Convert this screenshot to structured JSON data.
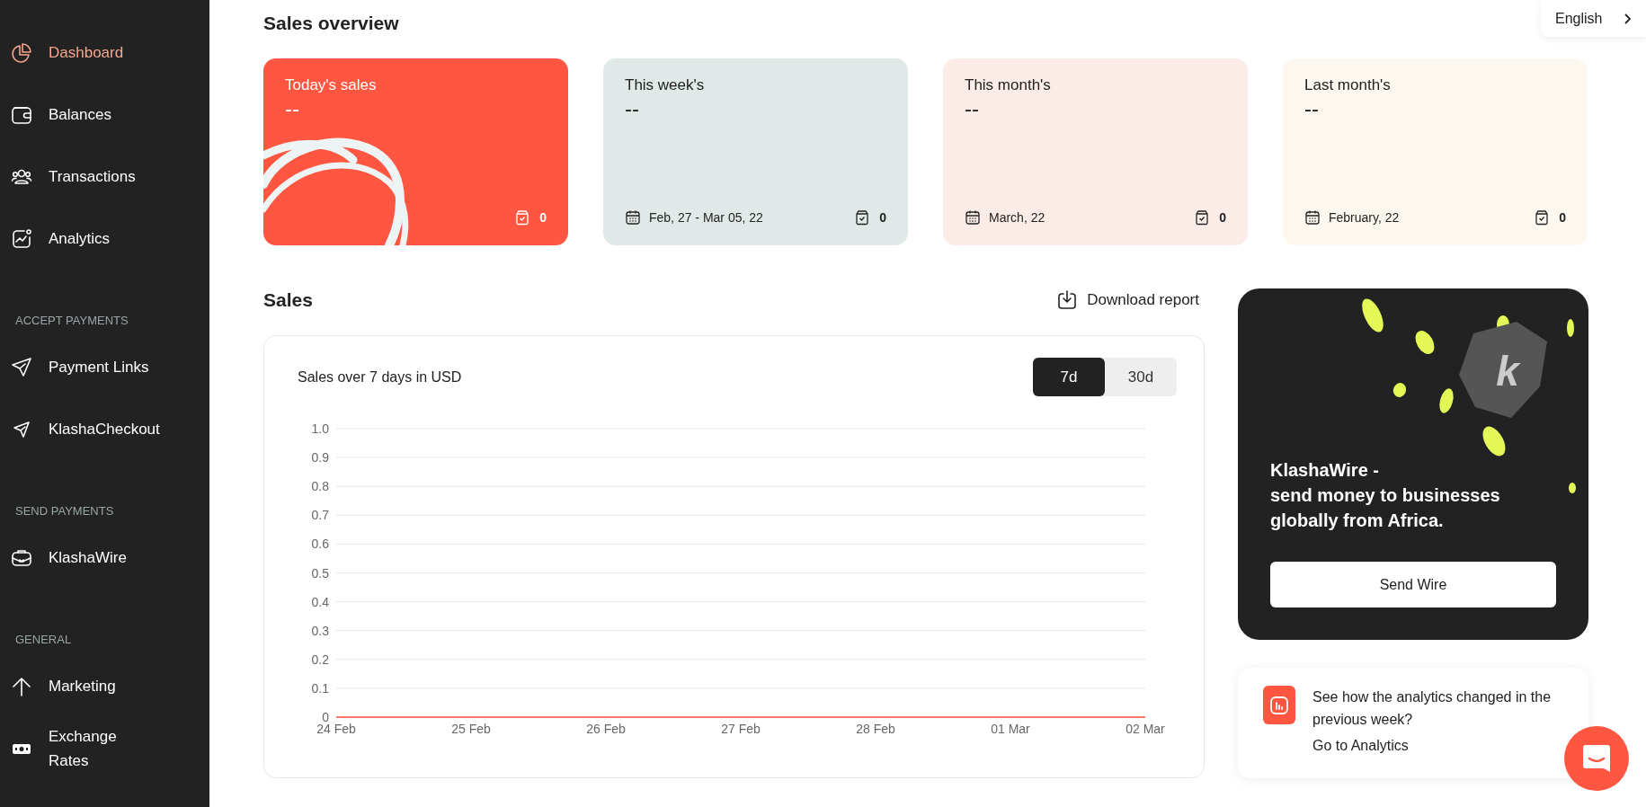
{
  "sidebar": {
    "sections": [
      {
        "items": [
          {
            "label": "Dashboard",
            "selected": true
          },
          {
            "label": "Balances",
            "selected": false
          },
          {
            "label": "Transactions",
            "selected": false
          },
          {
            "label": "Analytics",
            "selected": false
          }
        ]
      },
      {
        "title": "ACCEPT PAYMENTS",
        "items": [
          {
            "label": "Payment Links",
            "selected": false
          },
          {
            "label": "KlashaCheckout",
            "selected": false
          }
        ]
      },
      {
        "title": "SEND PAYMENTS",
        "items": [
          {
            "label": "KlashaWire",
            "selected": false
          }
        ]
      },
      {
        "title": "GENERAL",
        "items": [
          {
            "label": "Marketing",
            "selected": false
          },
          {
            "label": "Exchange Rates",
            "selected": false
          }
        ]
      }
    ]
  },
  "language": {
    "label": "English"
  },
  "overview": {
    "title": "Sales overview",
    "cards": [
      {
        "kind": "featured",
        "title": "Today's sales",
        "value": "--",
        "count": "0",
        "color": "#ff5641"
      },
      {
        "kind": "plain",
        "title": "This week's",
        "value": "--",
        "period": "Feb, 27 - Mar 05, 22",
        "count": "0",
        "color": "#e0e9e7"
      },
      {
        "kind": "plain",
        "title": "This month's",
        "value": "--",
        "period": "March, 22",
        "count": "0",
        "color": "#fbece8"
      },
      {
        "kind": "plain",
        "title": "Last month's",
        "value": "--",
        "period": "February, 22",
        "count": "0",
        "color": "#fcf8f0"
      }
    ]
  },
  "sales": {
    "title": "Sales",
    "download": "Download report",
    "chart_title": "Sales over 7 days in USD",
    "ranges": [
      {
        "label": "7d",
        "selected": true
      },
      {
        "label": "30d",
        "selected": false
      }
    ],
    "chart_data": {
      "type": "line",
      "categories": [
        "24 Feb",
        "25 Feb",
        "26 Feb",
        "27 Feb",
        "28 Feb",
        "01 Mar",
        "02 Mar"
      ],
      "series": [
        {
          "color": "#ff5641",
          "values": [
            0,
            0,
            0,
            0,
            0,
            0,
            0
          ]
        }
      ],
      "grid": true,
      "ylim": [
        0,
        1
      ],
      "yticks": [
        {
          "value": 0,
          "label": "0"
        },
        {
          "value": 0.1,
          "label": "0.1"
        },
        {
          "value": 0.2,
          "label": "0.2"
        },
        {
          "value": 0.3,
          "label": "0.3"
        },
        {
          "value": 0.4,
          "label": "0.4"
        },
        {
          "value": 0.5,
          "label": "0.5"
        },
        {
          "value": 0.6,
          "label": "0.6"
        },
        {
          "value": 0.7,
          "label": "0.7"
        },
        {
          "value": 0.8,
          "label": "0.8"
        },
        {
          "value": 0.9,
          "label": "0.9"
        },
        {
          "value": 1,
          "label": "1.0"
        }
      ]
    }
  },
  "promo": {
    "badge_letter": "k",
    "heading": "KlashaWire -\nsend money to businesses globally from Africa.",
    "button": "Send Wire"
  },
  "analytics_tip": {
    "text": "See how the analytics changed in the previous week?",
    "link": "Go to Analytics"
  }
}
